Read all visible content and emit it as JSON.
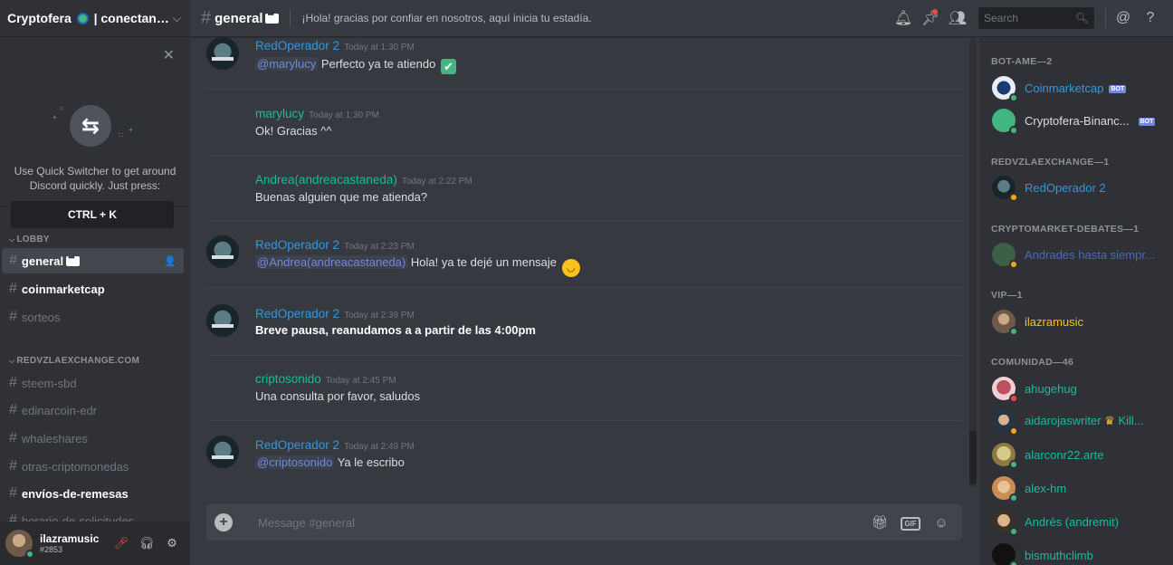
{
  "server": {
    "name": "Cryptofera",
    "name_suffix": "| conectand..."
  },
  "quick_switcher": {
    "text": "Use Quick Switcher to get around Discord quickly. Just press:",
    "shortcut": "CTRL + K"
  },
  "categories": [
    {
      "label": "LOBBY"
    },
    {
      "label": "REDVZLAEXCHANGE.COM"
    }
  ],
  "channels": [
    {
      "name": "general"
    },
    {
      "name": "coinmarketcap"
    },
    {
      "name": "sorteos"
    },
    {
      "name": "steem-sbd"
    },
    {
      "name": "edinarcoin-edr"
    },
    {
      "name": "whaleshares"
    },
    {
      "name": "otras-criptomonedas"
    },
    {
      "name": "envíos-de-remesas"
    },
    {
      "name": "horario-de-solicitudes"
    }
  ],
  "user": {
    "name": "ilazramusic",
    "tag": "#2853"
  },
  "topbar": {
    "channel": "general",
    "topic": "¡Hola! gracias por confiar en nosotros, aquí inicia tu estadía.",
    "search_placeholder": "Search"
  },
  "messages": [
    {
      "author": "RedOperador 2",
      "time": "Today at 1:30 PM",
      "mention": "@marylucy",
      "text": "Perfecto ya te atiendo"
    },
    {
      "author": "marylucy",
      "time": "Today at 1:30 PM",
      "text": "Ok! Gracias ^^"
    },
    {
      "author": "Andrea(andreacastaneda)",
      "time": "Today at 2:22 PM",
      "text": "Buenas alguien que me atienda?"
    },
    {
      "author": "RedOperador 2",
      "time": "Today at 2:23 PM",
      "mention": "@Andrea(andreacastaneda)",
      "text": "Hola! ya te dejé un mensaje"
    },
    {
      "author": "RedOperador 2",
      "time": "Today at 2:39 PM",
      "text": "Breve pausa, reanudamos a a partir de las 4:00pm"
    },
    {
      "author": "criptosonido",
      "time": "Today at 2:45 PM",
      "text": "Una consulta por favor, saludos"
    },
    {
      "author": "RedOperador 2",
      "time": "Today at 2:49 PM",
      "mention": "@criptosonido",
      "text": "Ya le escribo"
    }
  ],
  "composer": {
    "placeholder": "Message #general",
    "gif_label": "GIF"
  },
  "member_groups": [
    {
      "label": "BOT-AME—2"
    },
    {
      "label": "REDVZLAEXCHANGE—1"
    },
    {
      "label": "CRYPTOMARKET-DEBATES—1"
    },
    {
      "label": "VIP—1"
    },
    {
      "label": "COMUNIDAD—46"
    }
  ],
  "members": [
    {
      "name": "Coinmarketcap",
      "badge": "BOT",
      "color": "#3498db"
    },
    {
      "name": "Cryptofera-Binanc...",
      "badge": "BOT",
      "color": "#dcddde"
    },
    {
      "name": "RedOperador 2",
      "color": "#3498db"
    },
    {
      "name": "Andrades hasta siempr...",
      "color": "#4a6bb5"
    },
    {
      "name": "ilazramusic",
      "color": "#f1c40f"
    },
    {
      "name": "ahugehug",
      "color": "#1abc9c"
    },
    {
      "name": "aidarojaswriter",
      "extra": "Kill...",
      "color": "#1abc9c"
    },
    {
      "name": "alarconr22.arte",
      "color": "#1abc9c"
    },
    {
      "name": "alex-hm",
      "color": "#1abc9c"
    },
    {
      "name": "Andrés (andremit)",
      "color": "#1abc9c"
    },
    {
      "name": "bismuthclimb",
      "color": "#1abc9c"
    }
  ],
  "colors": {
    "accent_blue": "#3498db",
    "accent_teal": "#1abc9c",
    "online": "#43b581",
    "idle": "#faa61a",
    "dnd": "#f04747"
  }
}
